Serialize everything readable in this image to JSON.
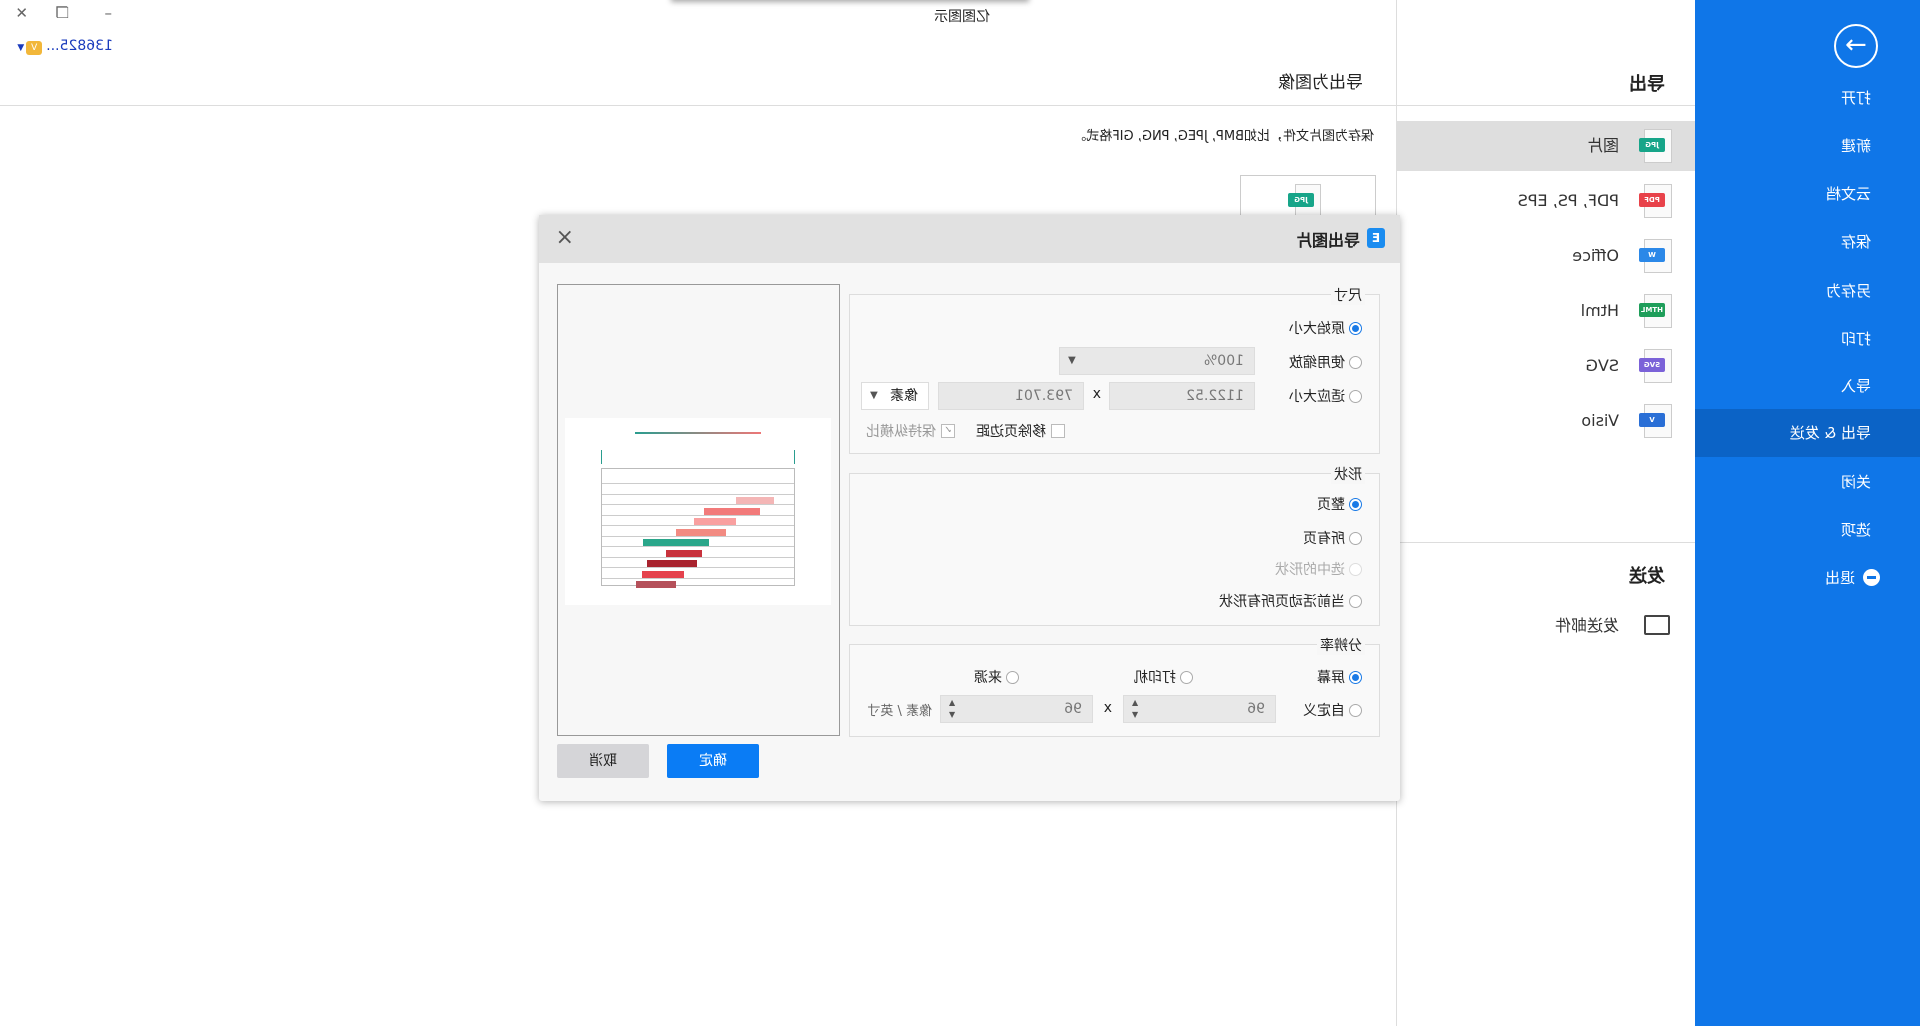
{
  "window": {
    "app_title": "亿图图示",
    "user": "136825...",
    "controls": {
      "close": "✕",
      "restore": "❐",
      "minimize": "–"
    }
  },
  "sidebar": {
    "back_icon": "arrow-right-circle-icon",
    "items": [
      {
        "label": "打开"
      },
      {
        "label": "新建"
      },
      {
        "label": "云文档"
      },
      {
        "label": "保存"
      },
      {
        "label": "另存为"
      },
      {
        "label": "打印"
      },
      {
        "label": "导入"
      },
      {
        "label": "导出 & 发送",
        "active": true
      },
      {
        "label": "关闭"
      },
      {
        "label": "选项"
      },
      {
        "label": "退出"
      }
    ],
    "color": "#0f76e8",
    "active_color": "#0b63c6"
  },
  "export_panel": {
    "title": "导出",
    "formats": [
      {
        "label": "图片",
        "tag": "JPG",
        "color": "#17a589",
        "active": true
      },
      {
        "label": "PDF, PS, EPS",
        "tag": "PDF",
        "color": "#e8424a"
      },
      {
        "label": "Office",
        "tag": "W",
        "color": "#2b88e8"
      },
      {
        "label": "Html",
        "tag": "HTML",
        "color": "#1e9e5a"
      },
      {
        "label": "SVG",
        "tag": "SVG",
        "color": "#7b62d8"
      },
      {
        "label": "Visio",
        "tag": "V",
        "color": "#2a6fd6"
      }
    ],
    "send_title": "发送",
    "send_items": [
      {
        "label": "发送邮件"
      }
    ]
  },
  "main": {
    "title": "导出为图像",
    "description": "保存为图片文件，比如BMP, JPEG, PNG, GIF格式。",
    "card_tag": "JPG"
  },
  "dialog": {
    "title": "导出图片",
    "logo": "E",
    "size": {
      "legend": "尺寸",
      "original": "原始大小",
      "use_zoom": "使用缩放",
      "zoom_value": "100%",
      "fit": "适应大小",
      "width": "1122.52",
      "x": "x",
      "height": "793.701",
      "unit": "像素",
      "remove_margin": "移除页边距",
      "keep_ratio": "保持纵横比"
    },
    "shape": {
      "legend": "形状",
      "whole_page": "整页",
      "all_pages": "所有页",
      "selected": "选中的形状",
      "active_page_all": "当前活动页所有形状"
    },
    "resolution": {
      "legend": "分辨率",
      "screen": "屏幕",
      "printer": "打印机",
      "source": "来源",
      "custom": "自定义",
      "dpi_x": "96",
      "x": "x",
      "dpi_y": "96",
      "unit": "像素 / 英寸"
    },
    "ok": "确定",
    "cancel": "取消"
  }
}
